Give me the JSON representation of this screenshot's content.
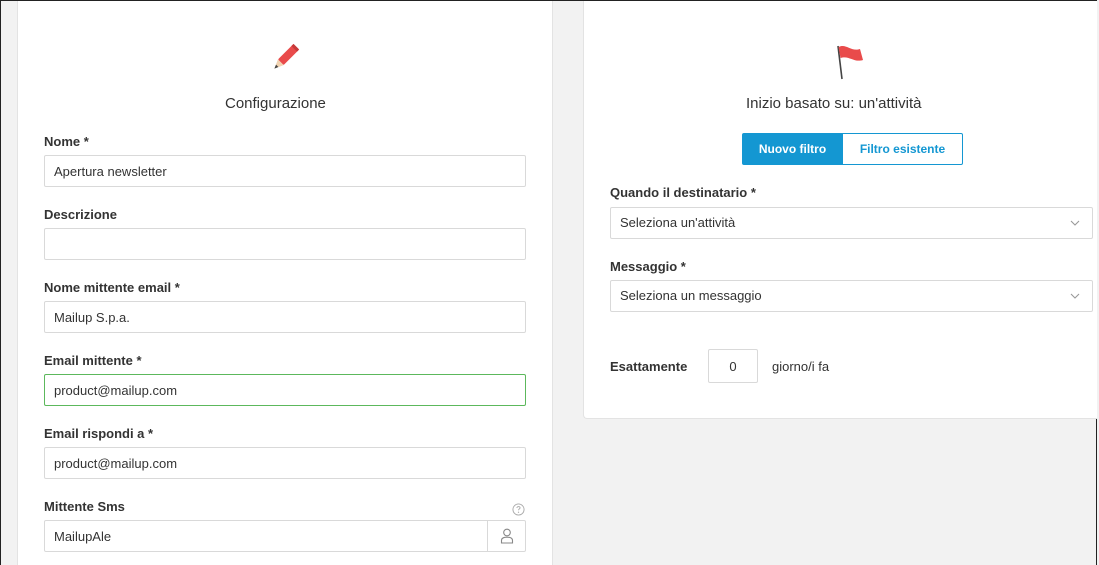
{
  "config": {
    "title": "Configurazione",
    "icon": "pencil-icon",
    "fields": {
      "nome": {
        "label": "Nome *",
        "value": "Apertura newsletter"
      },
      "descrizione": {
        "label": "Descrizione",
        "value": ""
      },
      "nome_mittente": {
        "label": "Nome mittente email *",
        "value": "Mailup S.p.a."
      },
      "email_mittente": {
        "label": "Email mittente *",
        "value": "product@mailup.com"
      },
      "email_rispondi": {
        "label": "Email rispondi a *",
        "value": "product@mailup.com"
      },
      "mittente_sms": {
        "label": "Mittente Sms",
        "value": "MailupAle",
        "help_icon": "question-circle-icon",
        "addon_icon": "user-icon"
      }
    }
  },
  "trigger": {
    "title": "Inizio basato su: un'attività",
    "icon": "flag-icon",
    "toggle": {
      "active": "Nuovo filtro",
      "inactive": "Filtro esistente"
    },
    "quando": {
      "label": "Quando il destinatario *",
      "placeholder": "Seleziona un'attività"
    },
    "messaggio": {
      "label": "Messaggio *",
      "placeholder": "Seleziona un messaggio"
    },
    "esattamente": {
      "label": "Esattamente",
      "value": "0",
      "suffix": "giorno/i fa"
    }
  },
  "colors": {
    "accent": "#1497d2",
    "focus": "#5cb85c",
    "flag": "#e94b4b",
    "pencil": "#e94b4b"
  }
}
